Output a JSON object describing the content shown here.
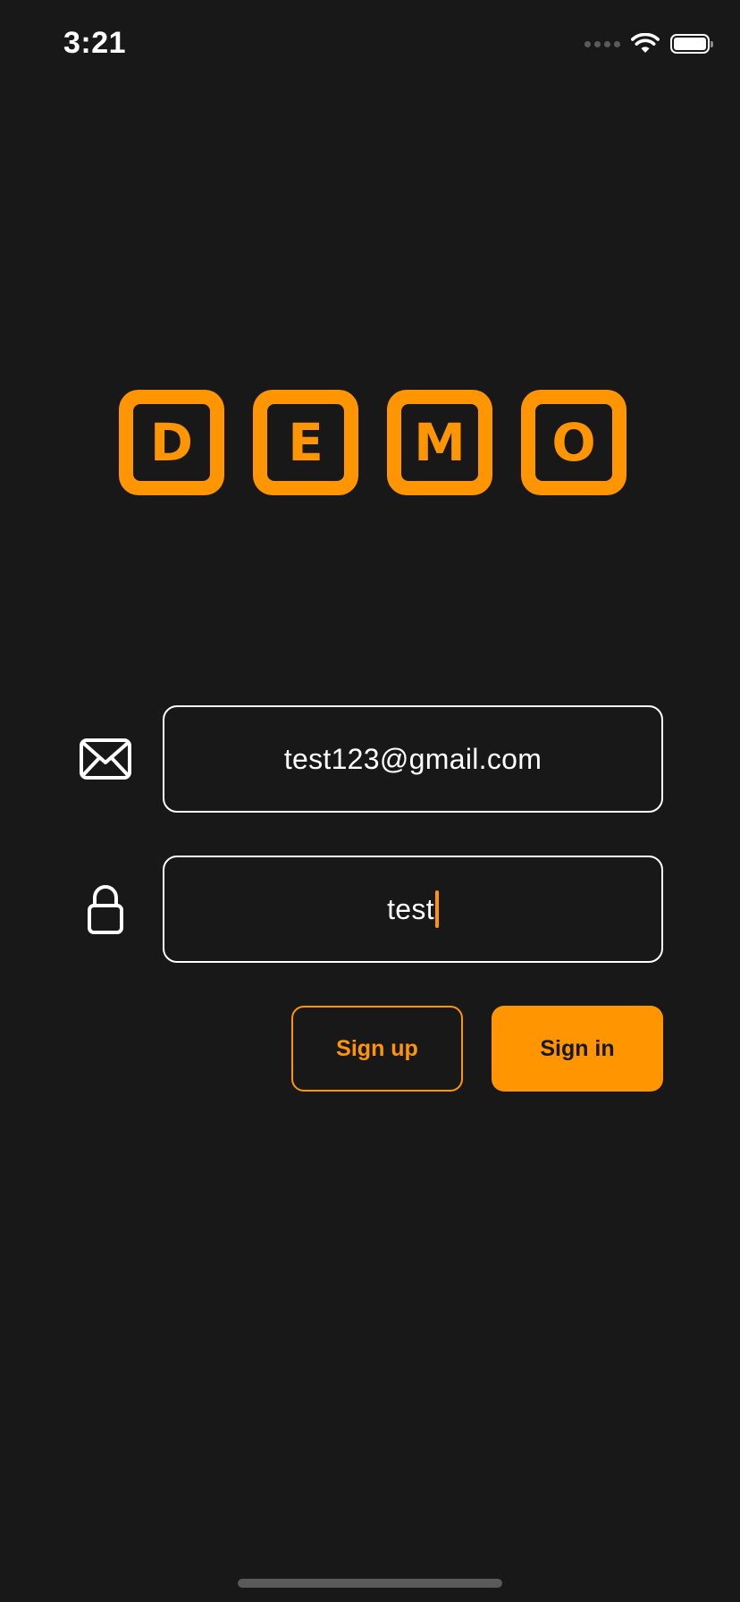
{
  "status_bar": {
    "time": "3:21",
    "icons": [
      "signal-icon",
      "wifi-icon",
      "battery-icon"
    ]
  },
  "logo": {
    "letters": [
      "D",
      "E",
      "M",
      "O"
    ],
    "color": "#ff9500"
  },
  "form": {
    "email": {
      "icon": "mail-icon",
      "value": "test123@gmail.com"
    },
    "password": {
      "icon": "lock-icon",
      "value": "test"
    }
  },
  "buttons": {
    "sign_up": "Sign up",
    "sign_in": "Sign in"
  },
  "colors": {
    "background": "#181818",
    "accent": "#ff9500",
    "text": "#ffffff"
  }
}
